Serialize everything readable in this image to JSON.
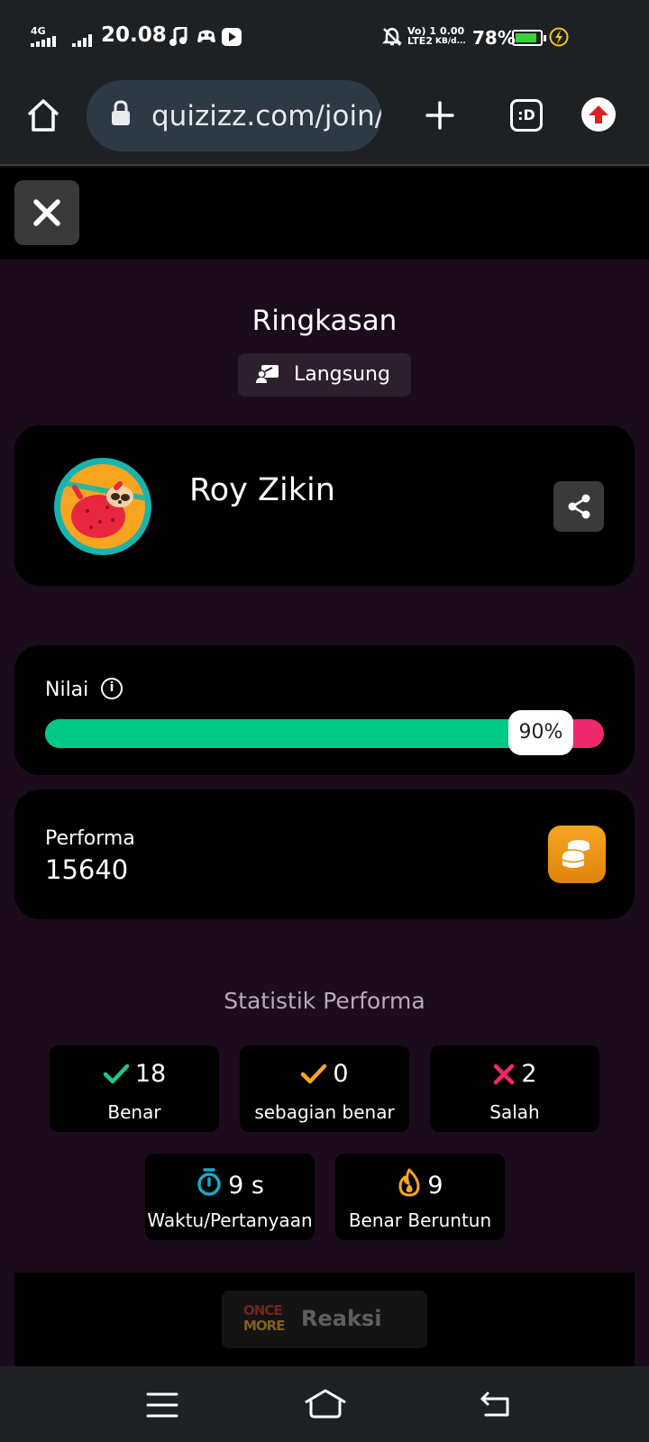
{
  "status_bar": {
    "network": "4G",
    "time": "20.08",
    "volte": "Vo) 1",
    "lte": "LTE2",
    "speed_value": "0.00",
    "speed_unit": "KB/d...",
    "battery": "78%"
  },
  "browser": {
    "url": "quizizz.com/join/",
    "tabs_label": ":D"
  },
  "summary": {
    "title": "Ringkasan",
    "mode": "Langsung"
  },
  "profile": {
    "name": "Roy Zikin"
  },
  "score": {
    "label": "Nilai",
    "percent_text": "90%",
    "percent": 90,
    "colors": {
      "correct": "#00c985",
      "incorrect": "#f0286e"
    }
  },
  "performance": {
    "label": "Performa",
    "value": "15640"
  },
  "stats": {
    "title": "Statistik Performa",
    "correct": {
      "value": "18",
      "label": "Benar"
    },
    "partial": {
      "value": "0",
      "label": "sebagian benar"
    },
    "wrong": {
      "value": "2",
      "label": "Salah"
    },
    "time": {
      "value": "9 s",
      "label": "Waktu/Pertanyaan"
    },
    "streak": {
      "value": "9",
      "label": "Benar Beruntun"
    }
  },
  "reaction": {
    "logo_line1": "ONCE",
    "logo_line2": "MORE",
    "label": "Reaksi"
  },
  "icons": {
    "home": "home-icon",
    "lock": "lock-icon",
    "new_tab": "plus-icon",
    "close": "close-icon",
    "share": "share-icon",
    "info": "info-icon",
    "coins": "coins-icon",
    "check": "check-icon",
    "cross": "cross-icon",
    "timer": "timer-icon",
    "flame": "flame-icon"
  }
}
